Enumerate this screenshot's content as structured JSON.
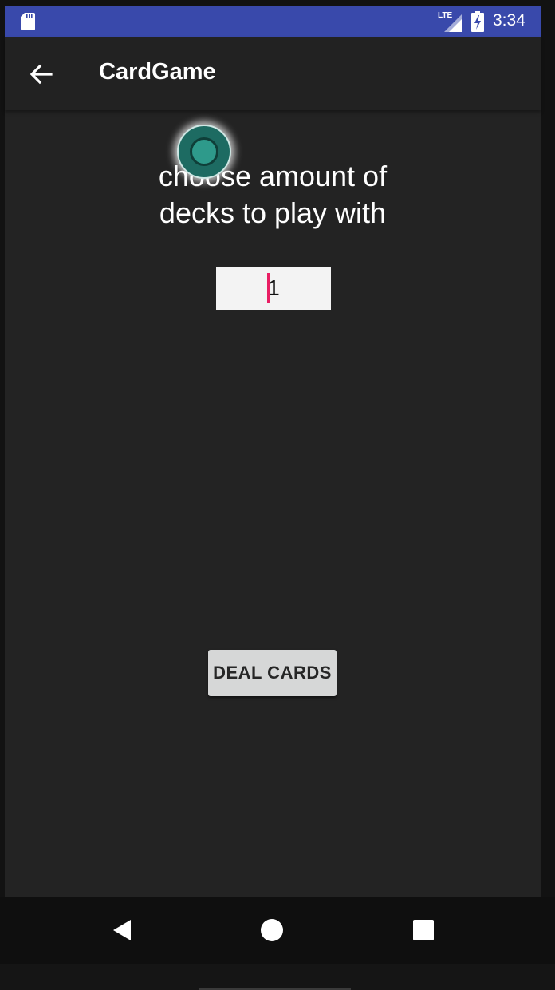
{
  "status_bar": {
    "sd_card_icon": "sd-card-icon",
    "network_label": "LTE",
    "signal_icon": "signal-icon",
    "battery_icon": "battery-charging-icon",
    "time": "3:34",
    "color": "#3949ab"
  },
  "app_bar": {
    "back_icon": "arrow-back-icon",
    "title": "CardGame"
  },
  "main": {
    "prompt_line1": "choose amount of",
    "prompt_line2": "decks to play with",
    "deck_count_value": "1",
    "deal_button_label": "DEAL CARDS",
    "touch_indicator": "touch-indicator-icon",
    "accent_color": "#e91e63"
  },
  "nav_bar": {
    "back_icon": "nav-back-icon",
    "home_icon": "nav-home-icon",
    "recents_icon": "nav-recents-icon"
  }
}
